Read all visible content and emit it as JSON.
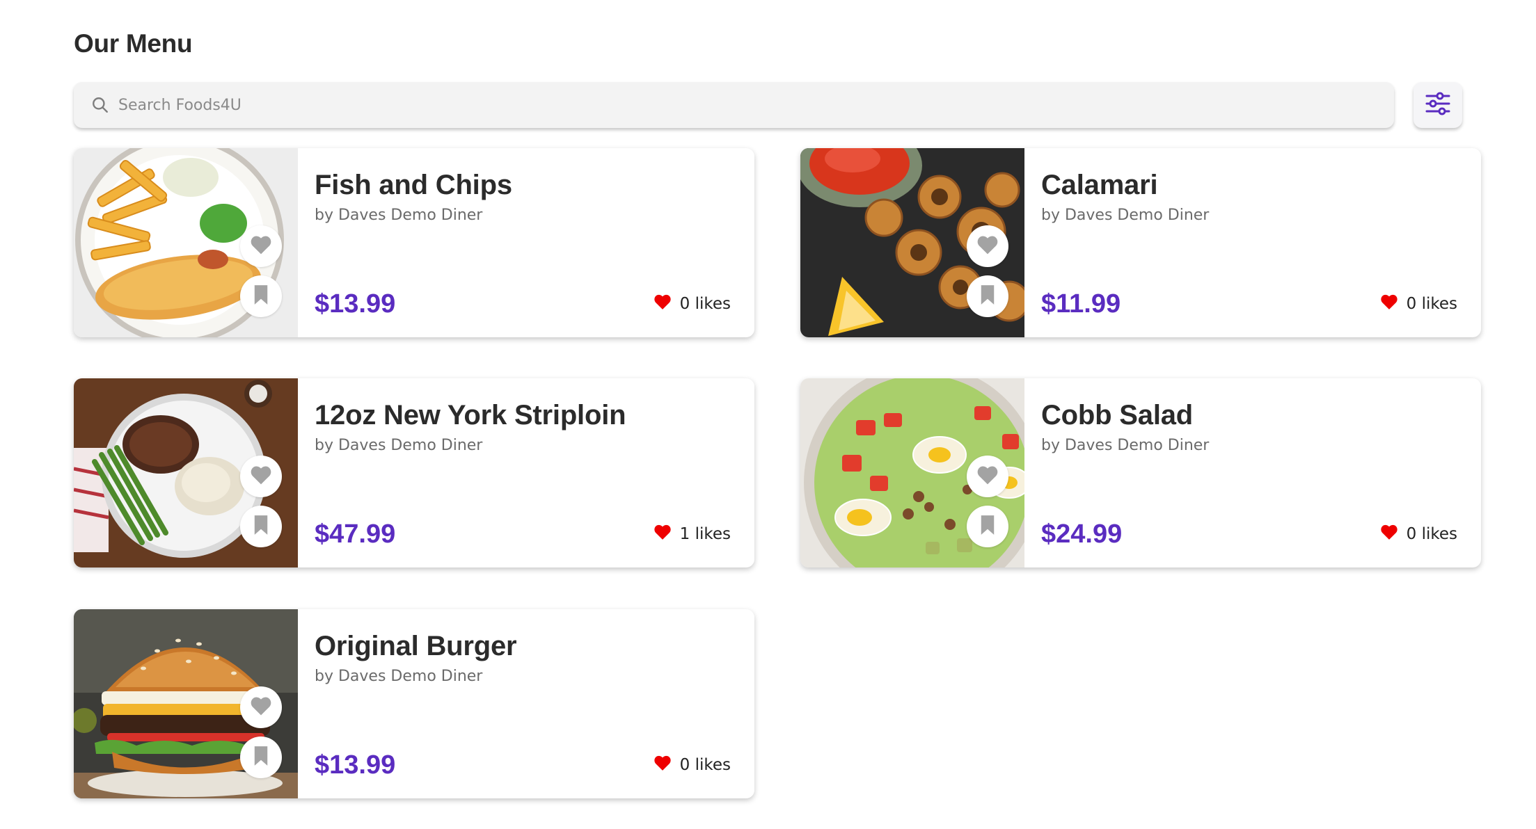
{
  "page": {
    "title": "Our Menu"
  },
  "search": {
    "placeholder": "Search Foods4U",
    "value": ""
  },
  "filter": {
    "icon": "sliders-icon"
  },
  "colors": {
    "price": "#5a2cc0",
    "heart": "#ee0000",
    "icon_gray": "#a3a3a3"
  },
  "items": [
    {
      "name": "Fish and Chips",
      "vendor": "by Daves Demo Diner",
      "price": "$13.99",
      "likes": "0 likes",
      "image": "fish-and-chips-photo"
    },
    {
      "name": "Calamari",
      "vendor": "by Daves Demo Diner",
      "price": "$11.99",
      "likes": "0 likes",
      "image": "calamari-photo"
    },
    {
      "name": "12oz New York Striploin",
      "vendor": "by Daves Demo Diner",
      "price": "$47.99",
      "likes": "1 likes",
      "image": "striploin-steak-photo"
    },
    {
      "name": "Cobb Salad",
      "vendor": "by Daves Demo Diner",
      "price": "$24.99",
      "likes": "0 likes",
      "image": "cobb-salad-photo"
    },
    {
      "name": "Original Burger",
      "vendor": "by Daves Demo Diner",
      "price": "$13.99",
      "likes": "0 likes",
      "image": "burger-photo"
    }
  ]
}
